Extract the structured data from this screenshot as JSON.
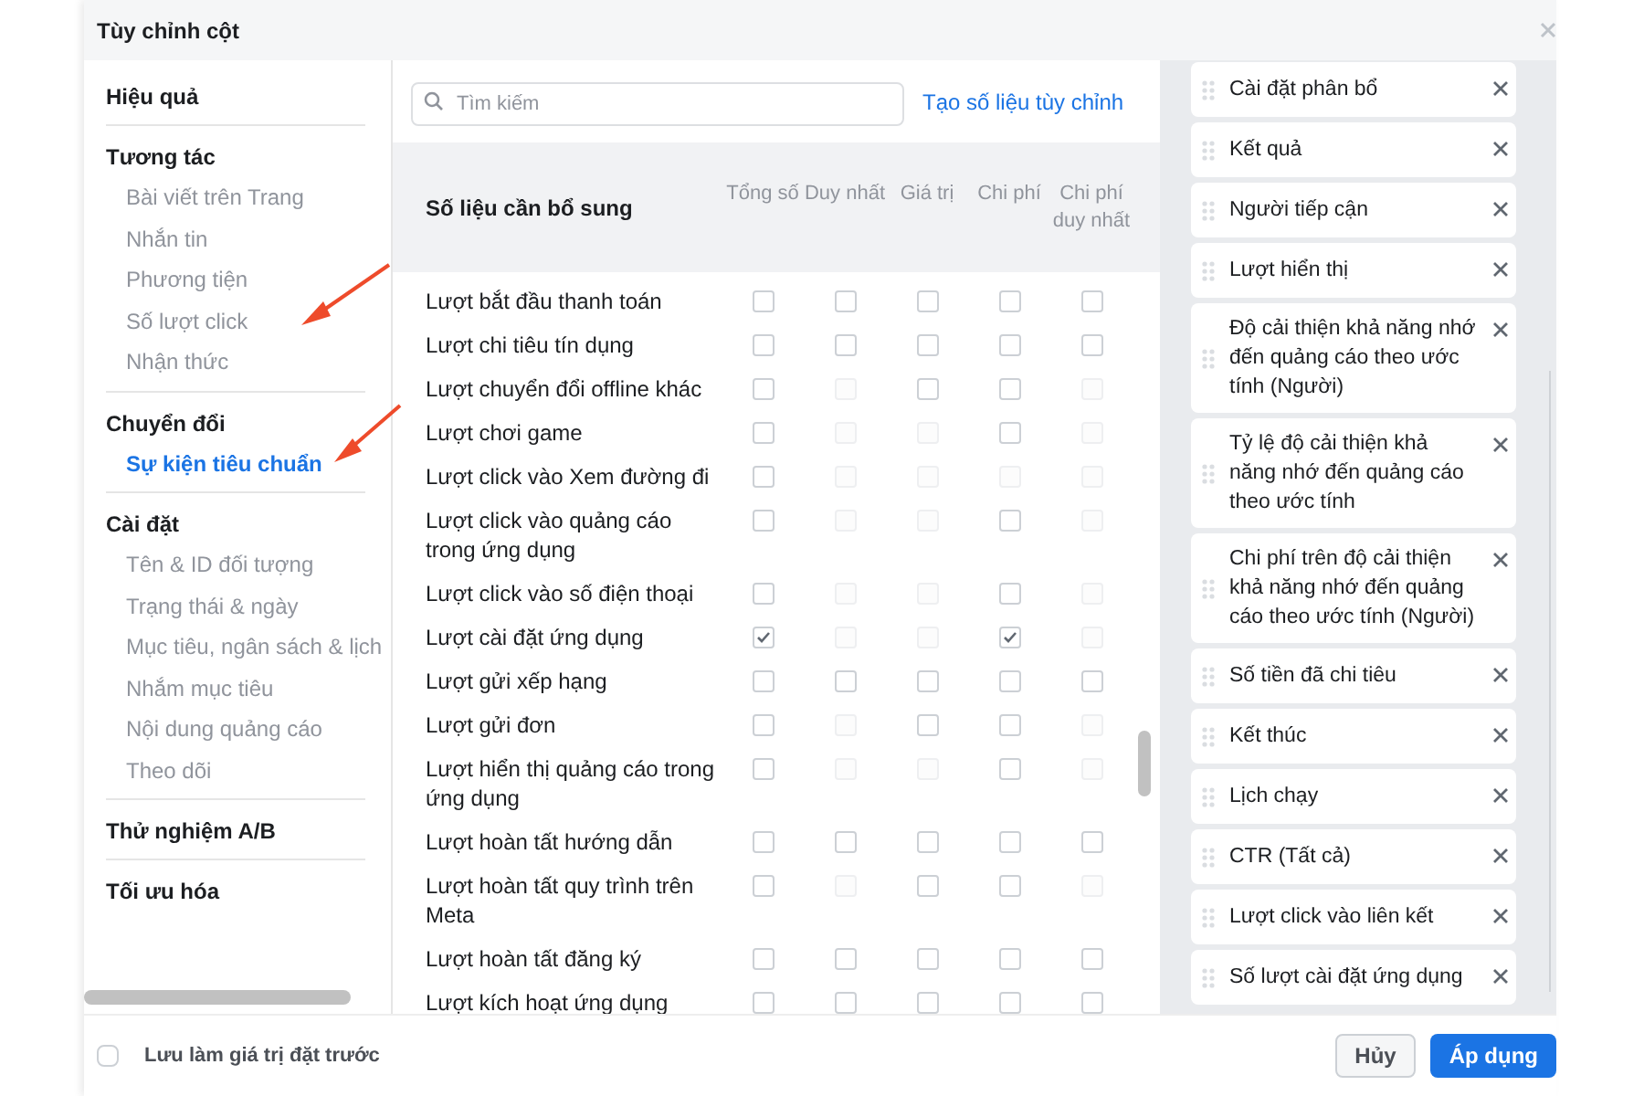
{
  "dialog": {
    "title": "Tùy chỉnh cột"
  },
  "sidebar": {
    "sections": [
      {
        "label": "Hiệu quả"
      },
      {
        "label": "Tương tác",
        "items": [
          {
            "label": "Bài viết trên Trang",
            "selected": false
          },
          {
            "label": "Nhắn tin",
            "selected": false
          },
          {
            "label": "Phương tiện",
            "selected": false
          },
          {
            "label": "Số lượt click",
            "selected": false
          },
          {
            "label": "Nhận thức",
            "selected": false
          }
        ]
      },
      {
        "label": "Chuyển đổi",
        "items": [
          {
            "label": "Sự kiện tiêu chuẩn",
            "selected": true
          }
        ]
      },
      {
        "label": "Cài đặt",
        "items": [
          {
            "label": "Tên & ID đối tượng",
            "selected": false
          },
          {
            "label": "Trạng thái & ngày",
            "selected": false
          },
          {
            "label": "Mục tiêu, ngân sách & lịch",
            "selected": false
          },
          {
            "label": "Nhắm mục tiêu",
            "selected": false
          },
          {
            "label": "Nội dung quảng cáo",
            "selected": false
          },
          {
            "label": "Theo dõi",
            "selected": false
          }
        ]
      },
      {
        "label": "Thử nghiệm A/B"
      },
      {
        "label": "Tối ưu hóa"
      }
    ]
  },
  "search": {
    "placeholder": "Tìm kiếm"
  },
  "custom_metric_link": "Tạo số liệu tùy chỉnh",
  "metrics_table": {
    "title": "Số liệu cần bổ sung",
    "columns": [
      "Tổng số",
      "Duy nhất",
      "Giá trị",
      "Chi phí",
      "Chi phí duy nhất"
    ],
    "rows": [
      {
        "label": "Lượt bắt đầu thanh toán",
        "cells": [
          {
            "checked": false,
            "disabled": false
          },
          {
            "checked": false,
            "disabled": false
          },
          {
            "checked": false,
            "disabled": false
          },
          {
            "checked": false,
            "disabled": false
          },
          {
            "checked": false,
            "disabled": false
          }
        ]
      },
      {
        "label": "Lượt chi tiêu tín dụng",
        "cells": [
          {
            "checked": false,
            "disabled": false
          },
          {
            "checked": false,
            "disabled": false
          },
          {
            "checked": false,
            "disabled": false
          },
          {
            "checked": false,
            "disabled": false
          },
          {
            "checked": false,
            "disabled": false
          }
        ]
      },
      {
        "label": "Lượt chuyển đổi offline khác",
        "cells": [
          {
            "checked": false,
            "disabled": false
          },
          {
            "checked": false,
            "disabled": true
          },
          {
            "checked": false,
            "disabled": false
          },
          {
            "checked": false,
            "disabled": false
          },
          {
            "checked": false,
            "disabled": true
          }
        ]
      },
      {
        "label": "Lượt chơi game",
        "cells": [
          {
            "checked": false,
            "disabled": false
          },
          {
            "checked": false,
            "disabled": true
          },
          {
            "checked": false,
            "disabled": true
          },
          {
            "checked": false,
            "disabled": false
          },
          {
            "checked": false,
            "disabled": true
          }
        ]
      },
      {
        "label": "Lượt click vào Xem đường đi",
        "cells": [
          {
            "checked": false,
            "disabled": false
          },
          {
            "checked": false,
            "disabled": true
          },
          {
            "checked": false,
            "disabled": true
          },
          {
            "checked": false,
            "disabled": true
          },
          {
            "checked": false,
            "disabled": true
          }
        ]
      },
      {
        "label": "Lượt click vào quảng cáo trong ứng dụng",
        "cells": [
          {
            "checked": false,
            "disabled": false
          },
          {
            "checked": false,
            "disabled": true
          },
          {
            "checked": false,
            "disabled": true
          },
          {
            "checked": false,
            "disabled": false
          },
          {
            "checked": false,
            "disabled": true
          }
        ]
      },
      {
        "label": "Lượt click vào số điện thoại",
        "cells": [
          {
            "checked": false,
            "disabled": false
          },
          {
            "checked": false,
            "disabled": true
          },
          {
            "checked": false,
            "disabled": true
          },
          {
            "checked": false,
            "disabled": false
          },
          {
            "checked": false,
            "disabled": true
          }
        ]
      },
      {
        "label": "Lượt cài đặt ứng dụng",
        "cells": [
          {
            "checked": true,
            "disabled": false
          },
          {
            "checked": false,
            "disabled": true
          },
          {
            "checked": false,
            "disabled": true
          },
          {
            "checked": true,
            "disabled": false
          },
          {
            "checked": false,
            "disabled": true
          }
        ]
      },
      {
        "label": "Lượt gửi xếp hạng",
        "cells": [
          {
            "checked": false,
            "disabled": false
          },
          {
            "checked": false,
            "disabled": false
          },
          {
            "checked": false,
            "disabled": false
          },
          {
            "checked": false,
            "disabled": false
          },
          {
            "checked": false,
            "disabled": false
          }
        ]
      },
      {
        "label": "Lượt gửi đơn",
        "cells": [
          {
            "checked": false,
            "disabled": false
          },
          {
            "checked": false,
            "disabled": true
          },
          {
            "checked": false,
            "disabled": false
          },
          {
            "checked": false,
            "disabled": false
          },
          {
            "checked": false,
            "disabled": true
          }
        ]
      },
      {
        "label": "Lượt hiển thị quảng cáo trong ứng dụng",
        "cells": [
          {
            "checked": false,
            "disabled": false
          },
          {
            "checked": false,
            "disabled": true
          },
          {
            "checked": false,
            "disabled": true
          },
          {
            "checked": false,
            "disabled": false
          },
          {
            "checked": false,
            "disabled": true
          }
        ]
      },
      {
        "label": "Lượt hoàn tất hướng dẫn",
        "cells": [
          {
            "checked": false,
            "disabled": false
          },
          {
            "checked": false,
            "disabled": false
          },
          {
            "checked": false,
            "disabled": false
          },
          {
            "checked": false,
            "disabled": false
          },
          {
            "checked": false,
            "disabled": false
          }
        ]
      },
      {
        "label": "Lượt hoàn tất quy trình trên Meta",
        "cells": [
          {
            "checked": false,
            "disabled": false
          },
          {
            "checked": false,
            "disabled": true
          },
          {
            "checked": false,
            "disabled": false
          },
          {
            "checked": false,
            "disabled": false
          },
          {
            "checked": false,
            "disabled": true
          }
        ]
      },
      {
        "label": "Lượt hoàn tất đăng ký",
        "cells": [
          {
            "checked": false,
            "disabled": false
          },
          {
            "checked": false,
            "disabled": false
          },
          {
            "checked": false,
            "disabled": false
          },
          {
            "checked": false,
            "disabled": false
          },
          {
            "checked": false,
            "disabled": false
          }
        ]
      },
      {
        "label": "Lượt kích hoạt ứng dụng",
        "cells": [
          {
            "checked": false,
            "disabled": false
          },
          {
            "checked": false,
            "disabled": false
          },
          {
            "checked": false,
            "disabled": false
          },
          {
            "checked": false,
            "disabled": false
          },
          {
            "checked": false,
            "disabled": false
          }
        ]
      }
    ]
  },
  "selected_columns": [
    "Cài đặt phân bổ",
    "Kết quả",
    "Người tiếp cận",
    "Lượt hiển thị",
    "Độ cải thiện khả năng nhớ đến quảng cáo theo ước tính (Người)",
    "Tỷ lệ độ cải thiện khả năng nhớ đến quảng cáo theo ước tính",
    "Chi phí trên độ cải thiện khả năng nhớ đến quảng cáo theo ước tính (Người)",
    "Số tiền đã chi tiêu",
    "Kết thúc",
    "Lịch chạy",
    "CTR (Tất cả)",
    "Lượt click vào liên kết",
    "Số lượt cài đặt ứng dụng"
  ],
  "footer": {
    "save_preset": {
      "label": "Lưu làm giá trị đặt trước",
      "checked": false
    },
    "buttons": [
      {
        "label": "Hủy",
        "kind": "secondary"
      },
      {
        "label": "Áp dụng",
        "kind": "primary"
      }
    ]
  }
}
